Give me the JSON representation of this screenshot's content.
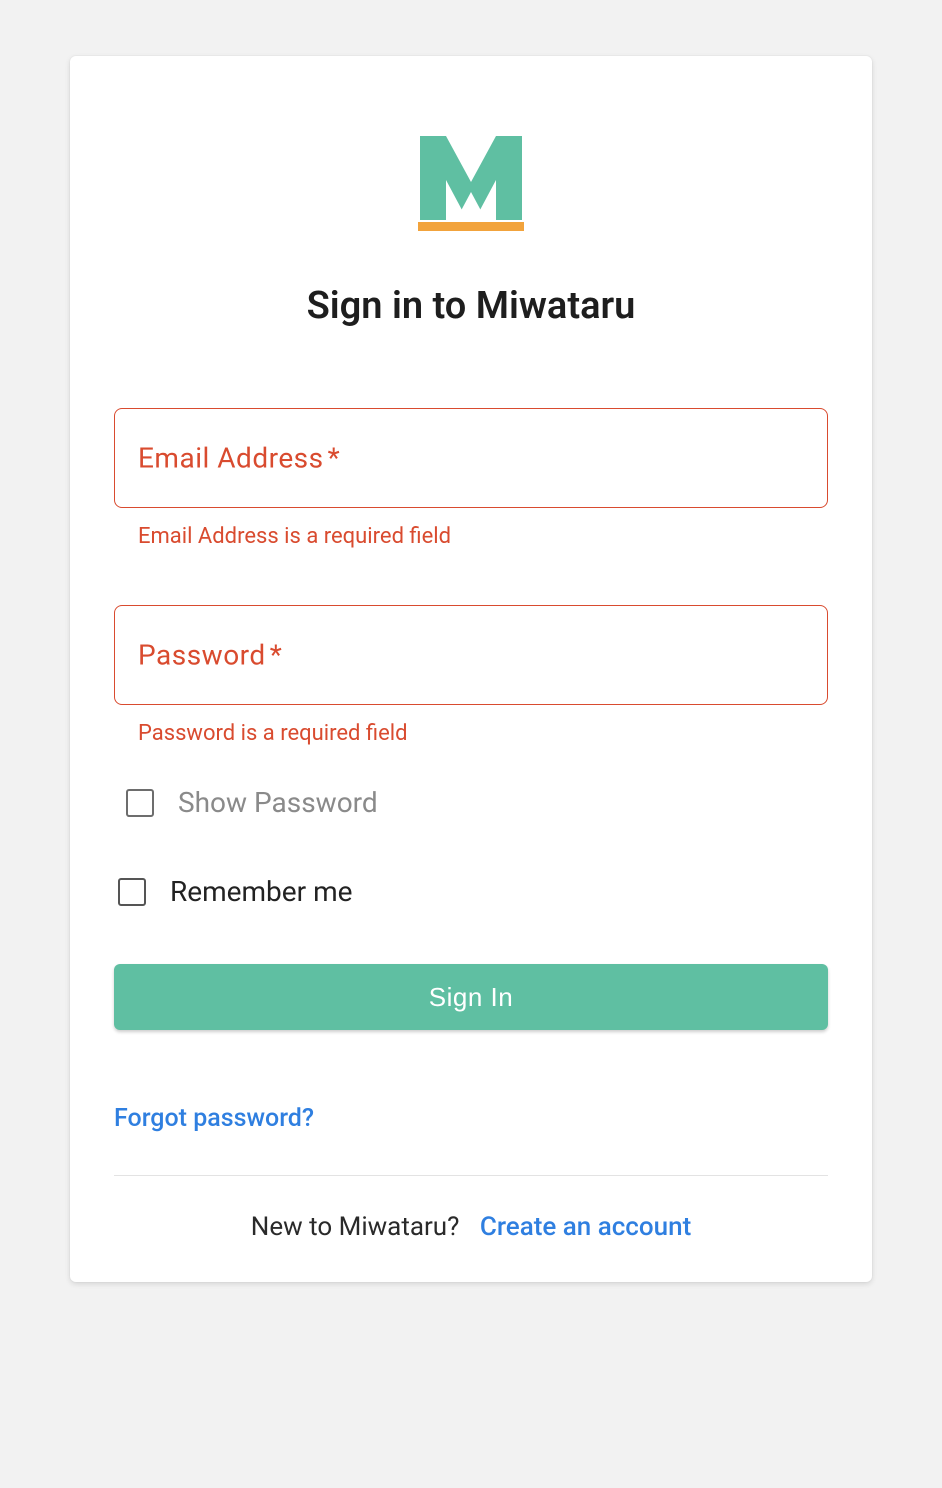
{
  "brand": {
    "name": "Miwataru",
    "logo_letter": "M",
    "logo_fill": "#5fbfa2",
    "logo_underline": "#f2a33c"
  },
  "title": "Sign in to Miwataru",
  "fields": {
    "email": {
      "label": "Email Address",
      "required_mark": "*",
      "value": "",
      "error": "Email Address is a required field"
    },
    "password": {
      "label": "Password",
      "required_mark": "*",
      "value": "",
      "error": "Password is a required field"
    }
  },
  "show_password": {
    "label": "Show Password",
    "checked": false
  },
  "remember_me": {
    "label": "Remember me",
    "checked": false
  },
  "buttons": {
    "sign_in": "Sign In"
  },
  "links": {
    "forgot": "Forgot password?",
    "new_prompt": "New to Miwataru?",
    "create_account": "Create an account"
  },
  "colors": {
    "error": "#d94b2f",
    "primary": "#5fbfa2",
    "link": "#2f7fe0"
  }
}
